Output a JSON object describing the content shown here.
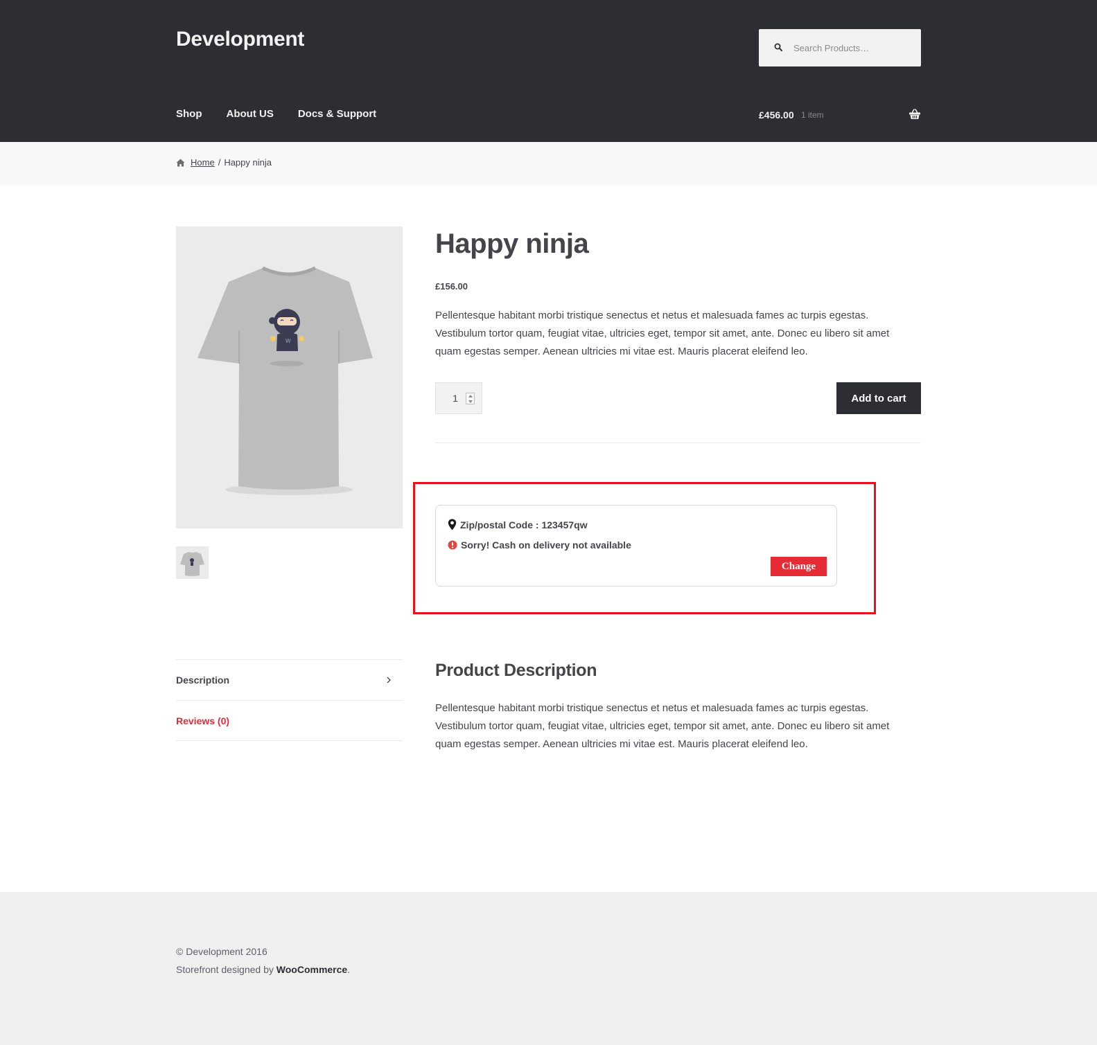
{
  "header": {
    "site_title": "Development",
    "search_placeholder": "Search Products…",
    "nav": [
      "Shop",
      "About US",
      "Docs & Support"
    ],
    "cart_total": "£456.00",
    "cart_count": "1 item",
    "bg_color": "#2d2e33"
  },
  "breadcrumb": {
    "home": "Home",
    "separator": "/",
    "current": "Happy ninja"
  },
  "product": {
    "title": "Happy ninja",
    "price": "£156.00",
    "short_description": "Pellentesque habitant morbi tristique senectus et netus et malesuada fames ac turpis egestas. Vestibulum tortor quam, feugiat vitae, ultricies eget, tempor sit amet, ante. Donec eu libero sit amet quam egestas semper. Aenean ultricies mi vitae est. Mauris placerat eleifend leo.",
    "quantity": "1",
    "add_to_cart_label": "Add to cart"
  },
  "cod": {
    "zip_text": "Zip/postal Code : 123457qw",
    "message": "Sorry! Cash on delivery not available",
    "change_label": "Change",
    "accent_color": "#e52b34",
    "highlight_color": "#e8101b"
  },
  "tabs": [
    {
      "label": "Description"
    },
    {
      "label": "Reviews (0)"
    }
  ],
  "description": {
    "heading": "Product Description",
    "body": "Pellentesque habitant morbi tristique senectus et netus et malesuada fames ac turpis egestas. Vestibulum tortor quam, feugiat vitae, ultricies eget, tempor sit amet, ante. Donec eu libero sit amet quam egestas semper. Aenean ultricies mi vitae est. Mauris placerat eleifend leo."
  },
  "footer": {
    "copyright": "© Development 2016",
    "credit_prefix": "Storefront designed by ",
    "credit_link": "WooCommerce",
    "credit_suffix": "."
  }
}
